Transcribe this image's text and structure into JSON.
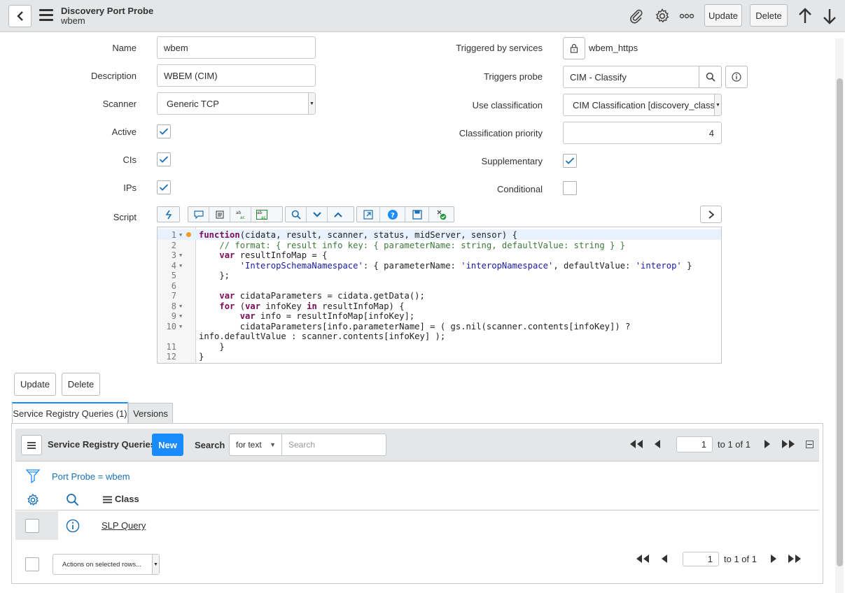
{
  "header": {
    "title": "Discovery Port Probe",
    "subtitle": "wbem",
    "update_label": "Update",
    "delete_label": "Delete",
    "more_label": "ooo"
  },
  "form": {
    "name_label": "Name",
    "name_value": "wbem",
    "description_label": "Description",
    "description_value": "WBEM (CIM)",
    "scanner_label": "Scanner",
    "scanner_value": "Generic TCP",
    "active_label": "Active",
    "active_checked": true,
    "cis_label": "CIs",
    "cis_checked": true,
    "ips_label": "IPs",
    "ips_checked": true,
    "script_label": "Script",
    "triggered_label": "Triggered by services",
    "triggered_value": "wbem_https",
    "triggers_probe_label": "Triggers probe",
    "triggers_probe_value": "CIM - Classify",
    "use_classification_label": "Use classification",
    "use_classification_value": "CIM Classification [discovery_classy",
    "classification_priority_label": "Classification priority",
    "classification_priority_value": "4",
    "supplementary_label": "Supplementary",
    "supplementary_checked": true,
    "conditional_label": "Conditional",
    "conditional_checked": false
  },
  "script": {
    "line_numbers": [
      "1",
      "2",
      "3",
      "4",
      "5",
      "6",
      "7",
      "8",
      "9",
      "10",
      "",
      "11",
      "12"
    ],
    "lines": [
      "function(cidata, result, scanner, status, midServer, sensor) {",
      "    // format: { result info key: { parameterName: string, defaultValue: string } }",
      "    var resultInfoMap = {",
      "        'InteropSchemaNamespace': { parameterName: 'interopNamespace', defaultValue: 'interop' }",
      "    };",
      "",
      "    var cidataParameters = cidata.getData();",
      "    for (var infoKey in resultInfoMap) {",
      "        var info = resultInfoMap[infoKey];",
      "        cidataParameters[info.parameterName] = ( gs.nil(scanner.contents[infoKey]) ?",
      "info.defaultValue : scanner.contents[infoKey] );",
      "    }",
      "}"
    ]
  },
  "buttons": {
    "update_label": "Update",
    "delete_label": "Delete"
  },
  "tabs": [
    {
      "label": "Service Registry Queries (1)",
      "active": true
    },
    {
      "label": "Versions",
      "active": false
    }
  ],
  "related_list": {
    "title": "Service Registry Queries",
    "new_label": "New",
    "search_label": "Search",
    "search_field": "for text",
    "search_placeholder": "Search",
    "page_value": "1",
    "page_total": "to 1 of 1",
    "filter_text": "Port Probe = wbem",
    "column_class": "Class",
    "rows": [
      {
        "class": "SLP Query"
      }
    ],
    "actions_label": "Actions on selected rows...",
    "bottom_page_value": "1",
    "bottom_page_total": "to 1 of 1"
  },
  "colors": {
    "accent": "#1a8cff",
    "link": "#1a70b5",
    "header_bg": "#e4e6e7"
  }
}
